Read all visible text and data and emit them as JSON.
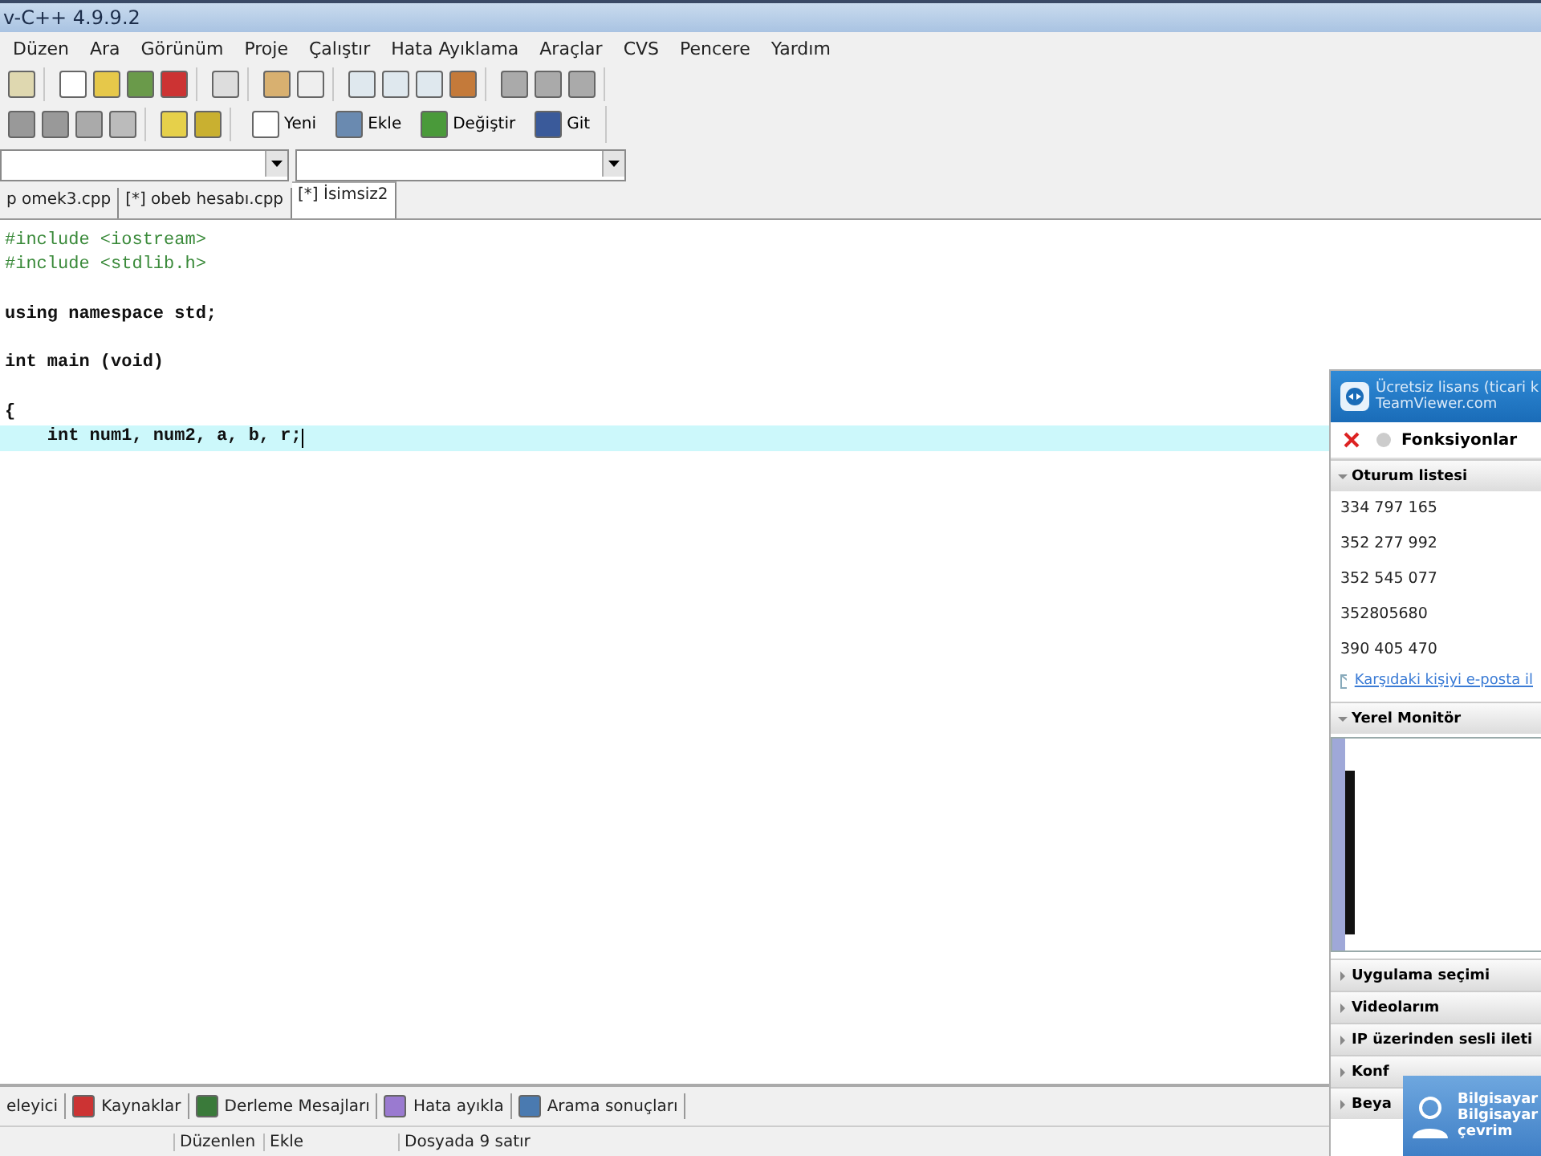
{
  "window": {
    "title": "v-C++ 4.9.9.2"
  },
  "menu": [
    "Düzen",
    "Ara",
    "Görünüm",
    "Proje",
    "Çalıştır",
    "Hata Ayıklama",
    "Araçlar",
    "CVS",
    "Pencere",
    "Yardım"
  ],
  "class_toolbar": {
    "buttons": [
      "Yeni",
      "Ekle",
      "Değiştir",
      "Git"
    ]
  },
  "file_tabs": [
    {
      "label": "p omek3.cpp",
      "selected": false
    },
    {
      "label": "[*] obeb hesabı.cpp",
      "selected": false
    },
    {
      "label": "[*] İsimsiz2",
      "selected": true
    }
  ],
  "editor": {
    "lines": [
      {
        "text": "#include <iostream>",
        "kind": "preprocessor",
        "highlighted": false
      },
      {
        "text": "#include <stdlib.h>",
        "kind": "preprocessor",
        "highlighted": false
      },
      {
        "kind": "blank",
        "highlighted": false
      },
      {
        "text": "using namespace std;",
        "kind": "code",
        "highlighted": false
      },
      {
        "kind": "blank",
        "highlighted": false
      },
      {
        "text": "int main (void)",
        "kind": "code",
        "highlighted": false
      },
      {
        "kind": "blank",
        "highlighted": false
      },
      {
        "text": "{",
        "kind": "code",
        "highlighted": false
      },
      {
        "text": "    int num1, num2, a, b, r;",
        "kind": "code",
        "highlighted": true
      }
    ]
  },
  "bottom_tabs": [
    "eleyici",
    "Kaynaklar",
    "Derleme Mesajları",
    "Hata ayıkla",
    "Arama sonuçları"
  ],
  "status_bar": [
    "Düzenlen",
    "Ekle",
    "Dosyada 9 satır"
  ],
  "teamviewer": {
    "banner": [
      "Ücretsiz lisans (ticari k",
      "TeamViewer.com"
    ],
    "functions": "Fonksiyonlar",
    "sections": [
      {
        "title": "Oturum listesi",
        "expanded": true,
        "kind": "list",
        "items": [
          "334 797 165",
          "352 277 992",
          "352 545 077",
          "352805680",
          "390 405 470"
        ],
        "link": "Karşıdaki kişiyi e-posta il"
      },
      {
        "title": "Yerel Monitör",
        "expanded": true,
        "kind": "monitor"
      },
      {
        "title": "Uygulama seçimi",
        "expanded": false
      },
      {
        "title": "Videolarım",
        "expanded": false
      },
      {
        "title": "IP üzerinden sesli ileti",
        "expanded": false
      },
      {
        "title": "Konf",
        "expanded": false
      },
      {
        "title": "Beya",
        "expanded": false
      }
    ],
    "popup": [
      "Bilgisayar",
      "Bilgisayar",
      "çevrim"
    ]
  }
}
